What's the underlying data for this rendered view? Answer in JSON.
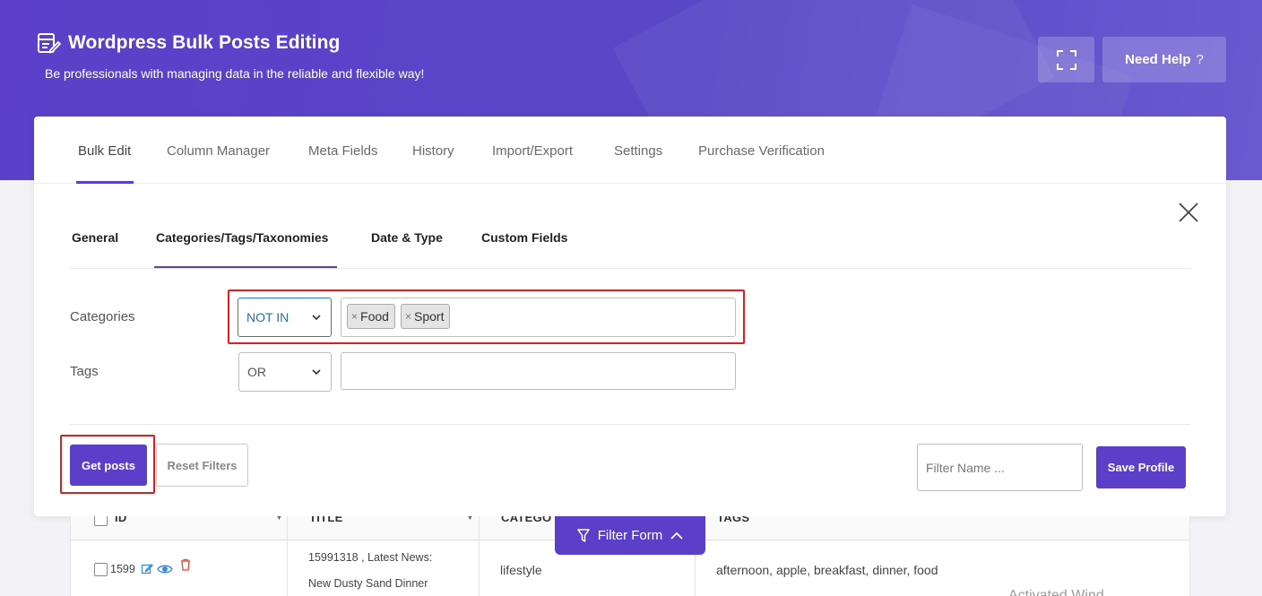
{
  "app": {
    "title": "Wordpress Bulk Posts Editing",
    "subtitle": "Be professionals with managing data in the reliable and flexible way!",
    "help_label": "Need Help",
    "help_suffix": "?"
  },
  "main_tabs": [
    {
      "label": "Bulk Edit",
      "active": true
    },
    {
      "label": "Column Manager"
    },
    {
      "label": "Meta Fields"
    },
    {
      "label": "History"
    },
    {
      "label": "Import/Export"
    },
    {
      "label": "Settings"
    },
    {
      "label": "Purchase Verification"
    }
  ],
  "filter": {
    "sub_tabs": [
      {
        "label": "General"
      },
      {
        "label": "Categories/Tags/Taxonomies",
        "active": true
      },
      {
        "label": "Date & Type"
      },
      {
        "label": "Custom Fields"
      }
    ],
    "categories": {
      "label": "Categories",
      "operator": "NOT IN",
      "chips": [
        {
          "label": "Food",
          "remove": "×"
        },
        {
          "label": "Sport",
          "remove": "×"
        }
      ]
    },
    "tags": {
      "label": "Tags",
      "operator": "OR",
      "value": ""
    },
    "get_posts_label": "Get posts",
    "reset_label": "Reset Filters",
    "filter_name_placeholder": "Filter Name ...",
    "save_profile_label": "Save Profile",
    "toggle_label": "Filter Form"
  },
  "table": {
    "columns": [
      "ID",
      "TITLE",
      "CATEGO",
      "TAGS"
    ],
    "rows": [
      {
        "id": "1599",
        "title_line1": "15991318 , Latest News:",
        "title_line2": "New Dusty Sand Dinner",
        "category": "lifestyle",
        "tags": "afternoon, apple, breakfast, dinner, food"
      }
    ]
  },
  "watermark": "Activated Wind",
  "colors": {
    "accent": "#5b3fc9",
    "highlight": "#e01c1c"
  }
}
